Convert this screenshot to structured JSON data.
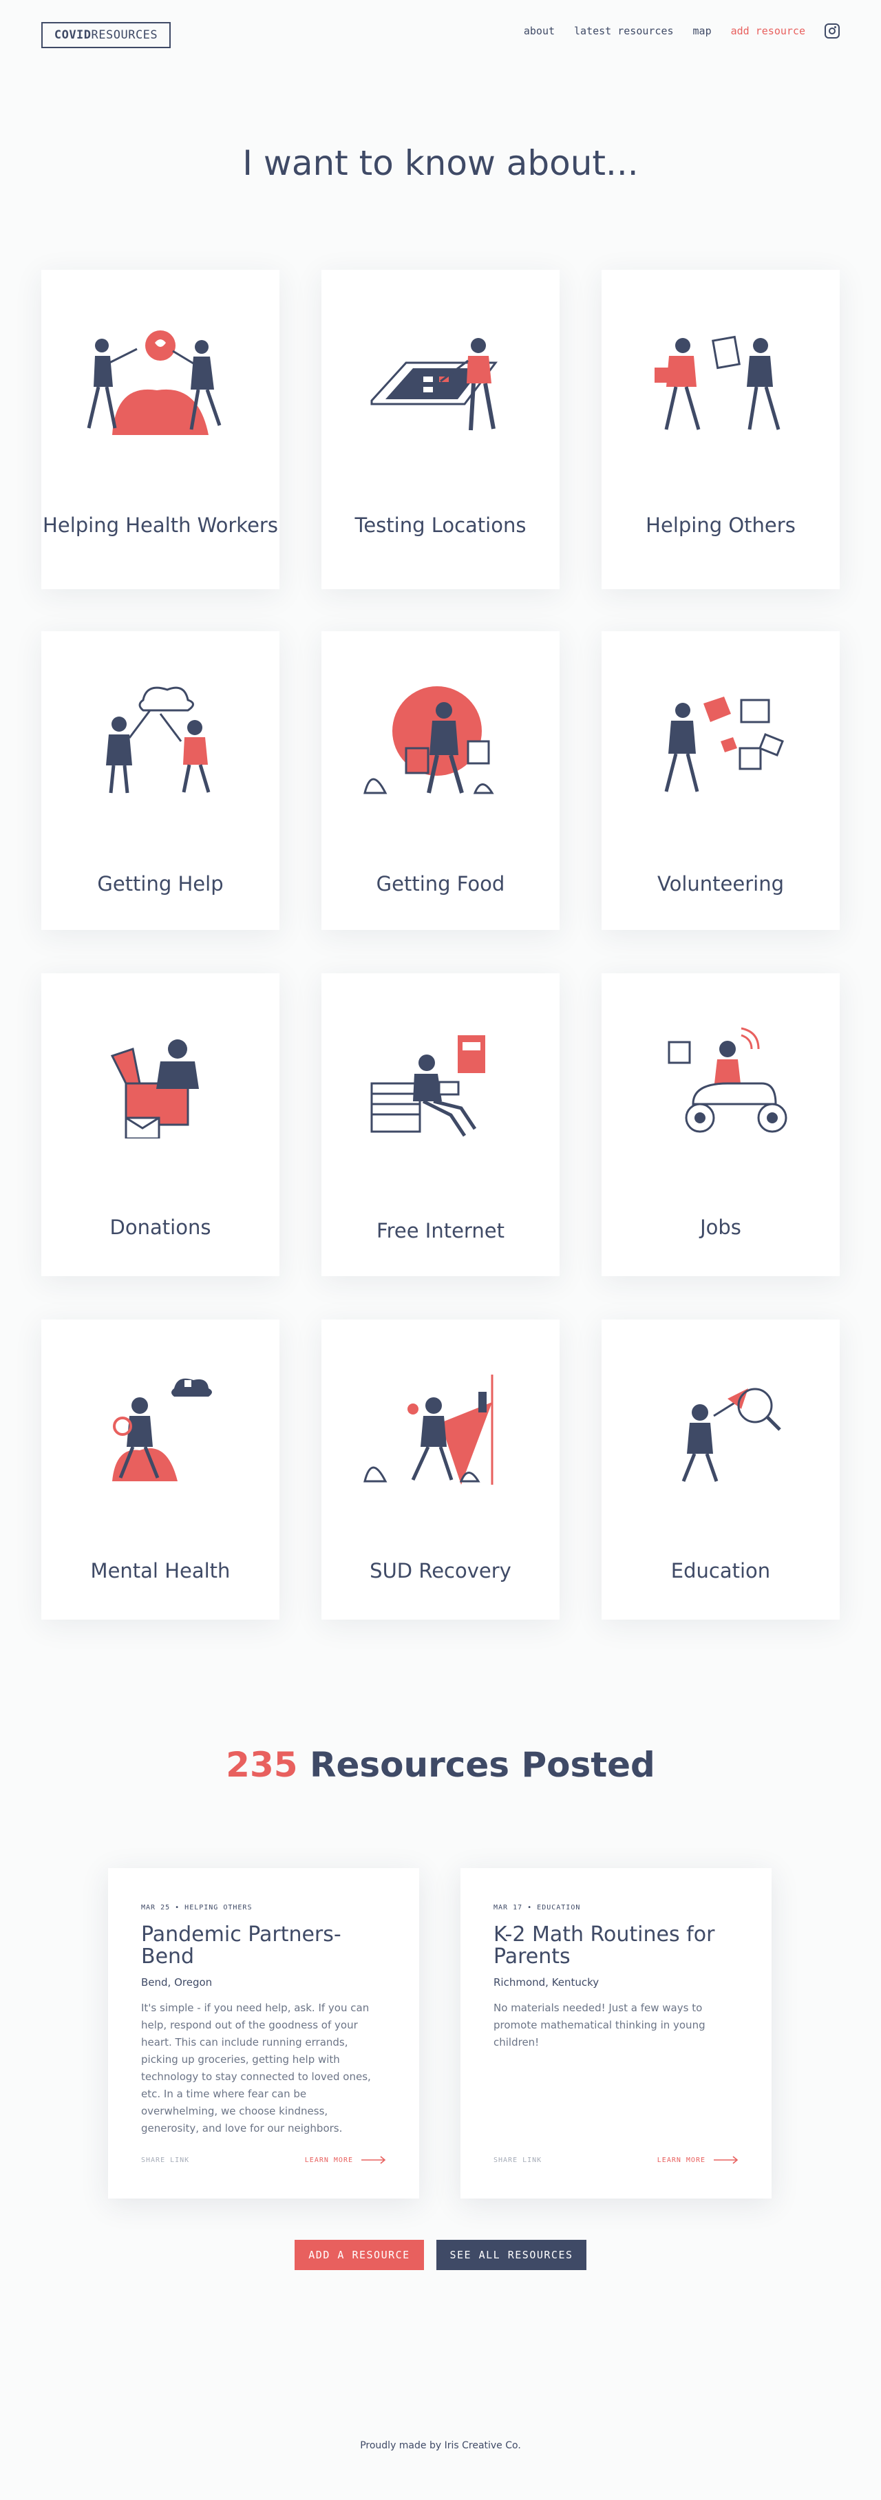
{
  "header": {
    "logo_bold": "COVID",
    "logo_rest": "RESOURCES",
    "nav": [
      {
        "label": "about"
      },
      {
        "label": "latest resources"
      },
      {
        "label": "map"
      },
      {
        "label": "add resource"
      }
    ],
    "social_icon": "instagram-icon"
  },
  "hero": {
    "title": "I want to know about..."
  },
  "topics": [
    {
      "label": "Helping Health Workers",
      "icon": "health-workers-illustration"
    },
    {
      "label": "Testing Locations",
      "icon": "testing-illustration"
    },
    {
      "label": "Helping Others",
      "icon": "helping-others-illustration"
    },
    {
      "label": "Getting Help",
      "icon": "getting-help-illustration"
    },
    {
      "label": "Getting Food",
      "icon": "getting-food-illustration"
    },
    {
      "label": "Volunteering",
      "icon": "volunteering-illustration"
    },
    {
      "label": "Donations",
      "icon": "donations-illustration"
    },
    {
      "label": "Free Internet",
      "icon": "free-internet-illustration"
    },
    {
      "label": "Jobs",
      "icon": "jobs-illustration"
    },
    {
      "label": "Mental Health",
      "icon": "mental-health-illustration"
    },
    {
      "label": "SUD Recovery",
      "icon": "sud-recovery-illustration"
    },
    {
      "label": "Education",
      "icon": "education-illustration"
    }
  ],
  "resources_section": {
    "count": "235",
    "title_rest": " Resources Posted"
  },
  "resources": [
    {
      "meta": "MAR 25 • HELPING OTHERS",
      "title": "Pandemic Partners-Bend",
      "location": "Bend, Oregon",
      "description": "It's simple - if you need help, ask. If you can help, respond out of the goodness of your heart. This can include running errands, picking up groceries, getting help with technology to stay connected to loved ones, etc. In a time where fear can be overwhelming, we choose kindness, generosity, and love for our neighbors.",
      "share_label": "SHARE LINK",
      "learn_label": "LEARN MORE"
    },
    {
      "meta": "MAR 17 • EDUCATION",
      "title": "K-2 Math Routines for Parents",
      "location": "Richmond, Kentucky",
      "description": "No materials needed! Just a few ways to promote mathematical thinking in young children!",
      "share_label": "SHARE LINK",
      "learn_label": "LEARN MORE"
    }
  ],
  "actions": {
    "add_label": "ADD A RESOURCE",
    "see_all_label": "SEE ALL RESOURCES"
  },
  "footer": {
    "text": "Proudly made by Iris Creative Co."
  },
  "colors": {
    "accent": "#e8605e",
    "primary": "#3f4a66",
    "background": "#fafbfb"
  }
}
